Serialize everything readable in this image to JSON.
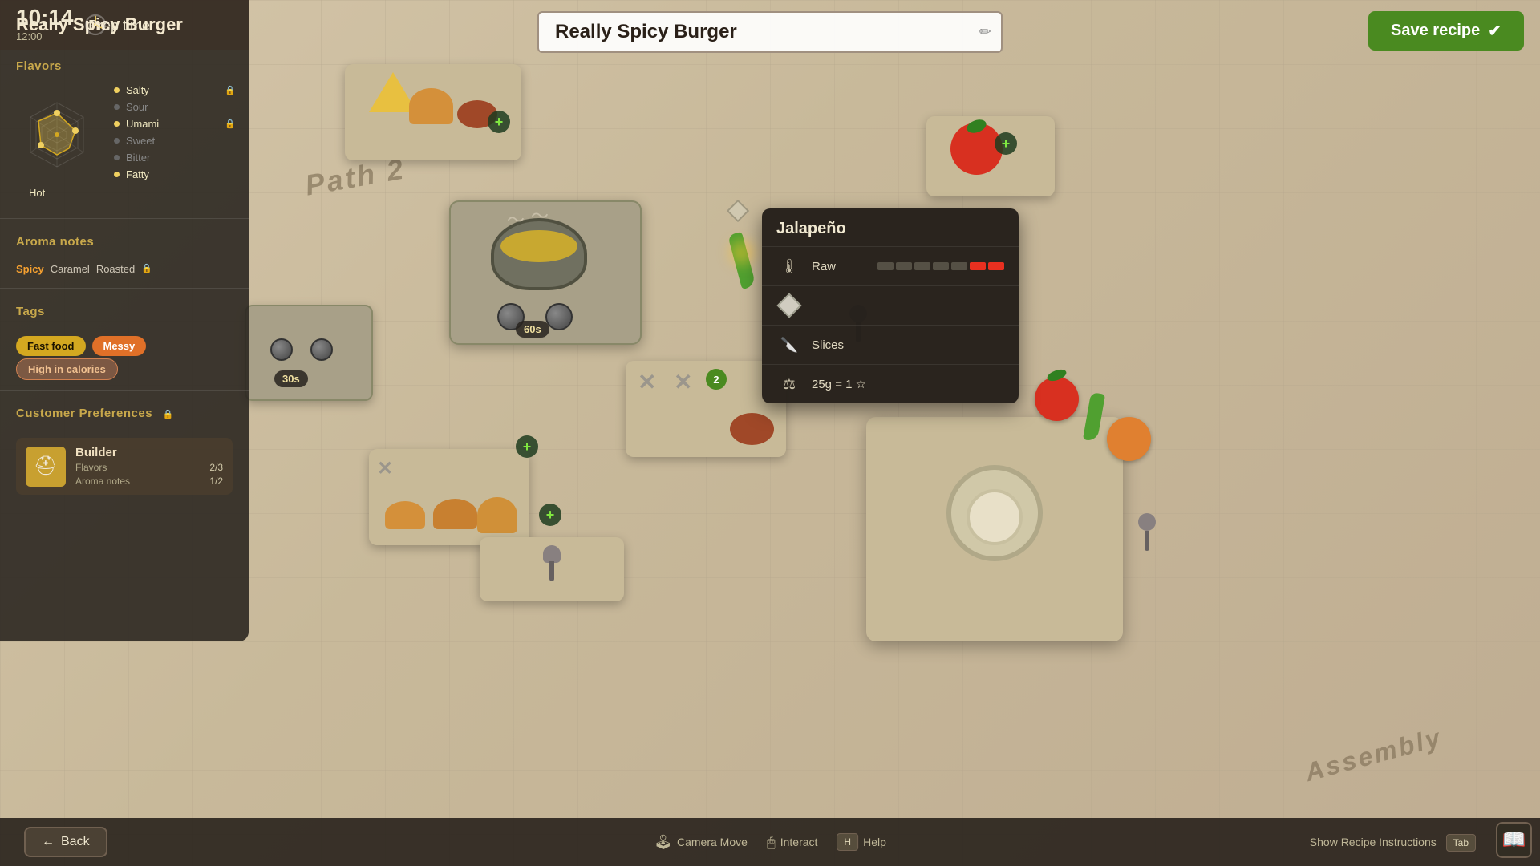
{
  "header": {
    "time_main": "10:14",
    "time_sub": "12:00",
    "prep_time": "Prep time",
    "recipe_name": "Really Spicy Burger",
    "edit_icon": "✏",
    "save_btn": "Save recipe",
    "save_check": "✔"
  },
  "sidebar": {
    "title": "Really Spicy Burger",
    "flavors_header": "Flavors",
    "flavors": [
      {
        "name": "Salty",
        "active": true,
        "locked": true
      },
      {
        "name": "Sour",
        "active": false,
        "locked": false
      },
      {
        "name": "Umami",
        "active": true,
        "locked": true
      },
      {
        "name": "Sweet",
        "active": false,
        "locked": false
      },
      {
        "name": "Bitter",
        "active": false,
        "locked": false
      },
      {
        "name": "Fatty",
        "active": true,
        "locked": false
      }
    ],
    "hot_label": "Hot",
    "aroma_header": "Aroma notes",
    "aroma_notes": [
      {
        "name": "Spicy",
        "highlight": true
      },
      {
        "name": "Caramel",
        "highlight": false
      },
      {
        "name": "Roasted",
        "highlight": false
      }
    ],
    "aroma_locked": true,
    "tags_header": "Tags",
    "tags": [
      {
        "name": "Fast food",
        "style": "yellow"
      },
      {
        "name": "Messy",
        "style": "orange"
      },
      {
        "name": "High in calories",
        "style": "pink"
      }
    ],
    "customer_header": "Customer Preferences",
    "customer_locked": true,
    "customer": {
      "name": "Builder",
      "flavors_label": "Flavors",
      "flavors_value": "2/3",
      "aroma_label": "Aroma notes",
      "aroma_value": "1/2"
    }
  },
  "tooltip": {
    "title": "Jalapeño",
    "rows": [
      {
        "icon": "🌡",
        "label": "Raw",
        "has_heat_bar": true,
        "heat_filled": 2,
        "heat_total": 7
      },
      {
        "icon": "💎",
        "label": "",
        "has_gem": true
      },
      {
        "icon": "🔪",
        "label": "Slices",
        "has_heat_bar": false
      },
      {
        "icon": "⚖",
        "label": "25g = 1 ☆",
        "has_heat_bar": false
      }
    ]
  },
  "workspace": {
    "path2_label": "Path 2",
    "assembly_label": "Assembly"
  },
  "bottom_bar": {
    "back_btn": "Back",
    "hints": [
      {
        "key": "🕹",
        "label": "Camera Move"
      },
      {
        "key": "🖱",
        "label": "Interact"
      },
      {
        "key": "H",
        "label": "Help"
      }
    ],
    "show_recipe": "Show Recipe Instructions",
    "tab_key": "Tab"
  }
}
